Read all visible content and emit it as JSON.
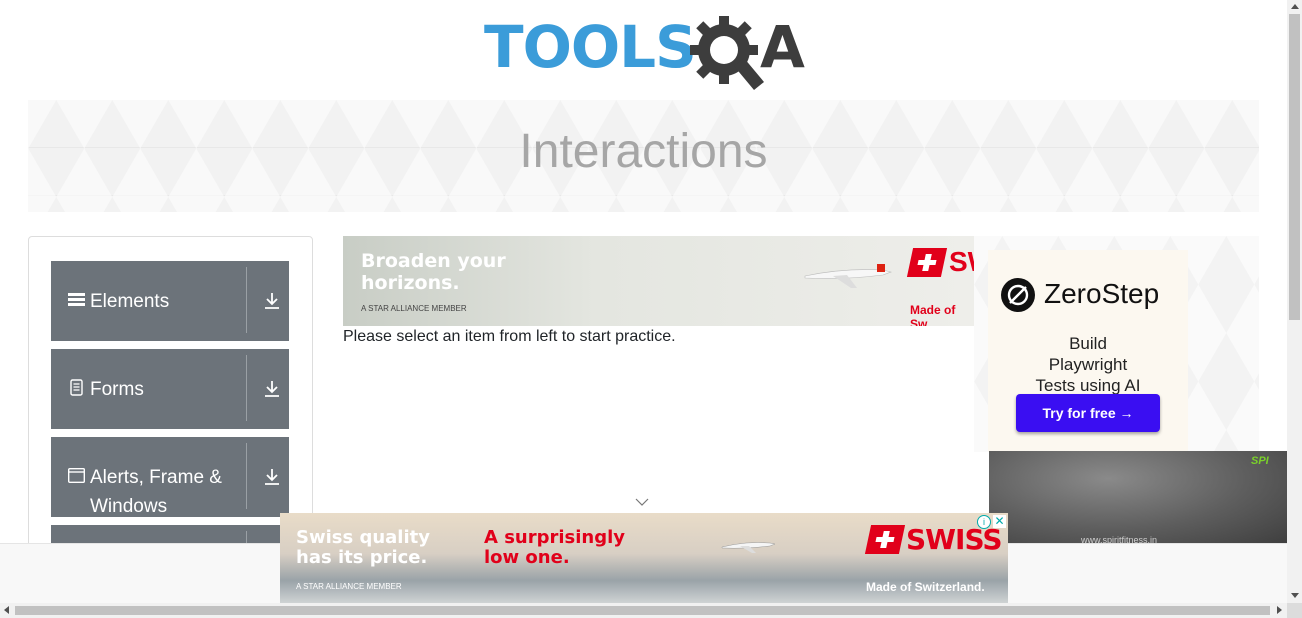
{
  "header": {
    "logo_text_tools": "TOOLS",
    "logo_text_a": "A",
    "logo_color_blue": "#3b9cd9",
    "logo_color_dark": "#3d3d3d"
  },
  "banner": {
    "title": "Interactions"
  },
  "sidebar": {
    "groups": [
      {
        "label": "Elements",
        "icon": "hamburger-icon"
      },
      {
        "label": "Forms",
        "icon": "document-icon"
      },
      {
        "label": "Alerts, Frame & Windows",
        "icon": "window-icon"
      },
      {
        "label": "",
        "icon": ""
      }
    ],
    "group_color": "#6c737a"
  },
  "main": {
    "instruction": "Please select an item from left to start practice."
  },
  "ads": {
    "top": {
      "headline": "Broaden your horizons.",
      "alliance": "A STAR ALLIANCE MEMBER",
      "brand_partial": "SW",
      "tagline_partial": "Made of Sw"
    },
    "right": {
      "brand": "ZeroStep",
      "headline": "Build Playwright Tests using AI",
      "cta": "Try for free →",
      "cta_color": "#3a0ef2",
      "video_brand": "SPI",
      "video_caption": "www.spiritfitness.in"
    },
    "bottom": {
      "headline_left": "Swiss quality has its price.",
      "headline_right": "A surprisingly low one.",
      "brand": "SWISS",
      "alliance": "A STAR ALLIANCE MEMBER",
      "tagline": "Made of Switzerland.",
      "accent_color": "#e1001a"
    }
  }
}
